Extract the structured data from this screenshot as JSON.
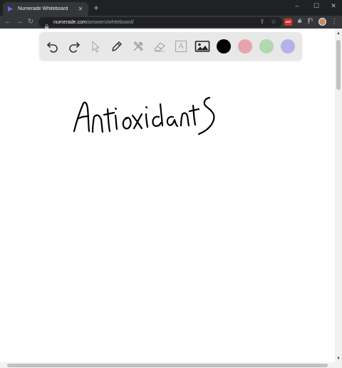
{
  "browser": {
    "tab": {
      "title": "Numerade Whiteboard",
      "close_glyph": "✕"
    },
    "new_tab_glyph": "+",
    "window_controls": {
      "minimize": "–",
      "maximize": "☐",
      "close": "✕"
    },
    "nav": {
      "back": "←",
      "forward": "→",
      "reload": "↻"
    },
    "url": {
      "host": "numerade.com",
      "path": "/answers/whiteboard/"
    },
    "omnibox_icons": {
      "share": "⇪",
      "bookmark": "☆"
    },
    "extension_badge": "ABP",
    "menu_glyph": "⋮"
  },
  "whiteboard": {
    "tools": [
      {
        "name": "undo-icon"
      },
      {
        "name": "redo-icon"
      },
      {
        "name": "pointer-icon"
      },
      {
        "name": "pen-icon"
      },
      {
        "name": "tools-icon"
      },
      {
        "name": "eraser-icon"
      },
      {
        "name": "text-icon",
        "glyph": "A"
      },
      {
        "name": "image-icon"
      }
    ],
    "colors": [
      "#000000",
      "#e8a4ac",
      "#b2d8b0",
      "#b4b2ec"
    ],
    "handwriting": "Antioxidants"
  },
  "scrollbar": {
    "up": "▲",
    "down": "▼"
  }
}
